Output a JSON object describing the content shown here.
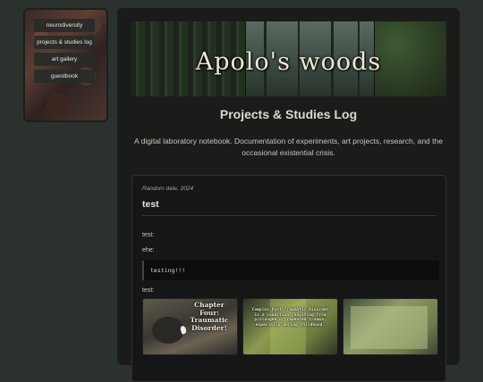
{
  "nav": {
    "items": [
      {
        "label": "neurodiversity"
      },
      {
        "label": "projects & studies log"
      },
      {
        "label": "art gallery"
      },
      {
        "label": "guestbook"
      }
    ]
  },
  "banner": {
    "title": "Apolo's woods"
  },
  "page": {
    "title": "Projects & Studies Log",
    "description": "A digital laboratory notebook. Documentation of experiments, art projects, research, and the occasional existential crisis."
  },
  "entry": {
    "date": "Random date, 2024",
    "title": "test",
    "paragraphs": [
      "test:",
      "ehe:",
      "test:"
    ],
    "code": "testing!!!",
    "gallery": [
      {
        "caption": "Chapter Four: Traumatic Disorder!"
      },
      {
        "caption": "Complex Post Traumatic Disorder is a condition resulting from prolonged or repeated trauma, especially during childhood."
      },
      {
        "caption": ""
      }
    ]
  },
  "colors": {
    "background": "#2b322e",
    "panel": "#1b1b1a",
    "text": "#d6d2cc"
  }
}
